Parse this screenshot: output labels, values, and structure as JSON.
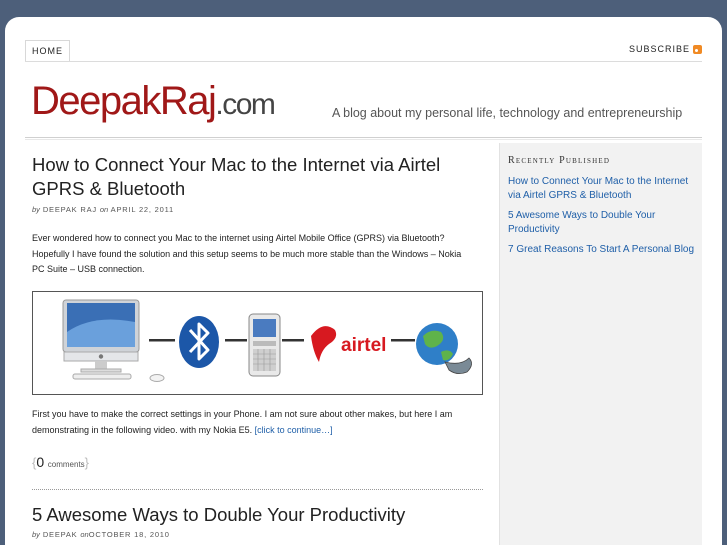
{
  "nav": {
    "home": "HOME",
    "subscribe": "SUBSCRIBE"
  },
  "header": {
    "logo_part1": "Deepak",
    "logo_part2": "Raj",
    "logo_part3": ".com",
    "tagline": "A blog about my personal life, technology and entrepreneurship"
  },
  "sidebar": {
    "heading": "Recently Published",
    "links": [
      "How to Connect Your Mac to the Internet via Airtel GPRS & Bluetooth",
      "5 Awesome Ways to Double Your Productivity",
      "7 Great Reasons To Start A Personal Blog"
    ]
  },
  "posts": [
    {
      "title": "How to Connect Your Mac to the Internet via Airtel GPRS & Bluetooth",
      "by": "by",
      "author": "DEEPAK RAJ",
      "on": "on",
      "date": "APRIL 22, 2011",
      "intro": "Ever wondered how to connect you Mac to the internet using Airtel Mobile Office (GPRS) via Bluetooth? Hopefully I have found the solution and this setup seems to be much more stable than the Windows – Nokia PC Suite – USB connection.",
      "body": "First you have to make the correct settings in your Phone. I am not sure about other makes, but here I am demonstrating in the following video. with my Nokia E5.",
      "more_link": "[click to continue…]",
      "comment_count": "0",
      "comments_label": "comments",
      "figure": {
        "airtel_word": "airtel"
      }
    },
    {
      "title": "5 Awesome Ways to Double Your Productivity",
      "by": "by",
      "author": "DEEPAK",
      "on": "on",
      "date": "OCTOBER 18, 2010"
    }
  ],
  "colors": {
    "background": "#4d5f7a",
    "link": "#1f5fa8",
    "logo": "#a01818",
    "airtel": "#d71920"
  }
}
